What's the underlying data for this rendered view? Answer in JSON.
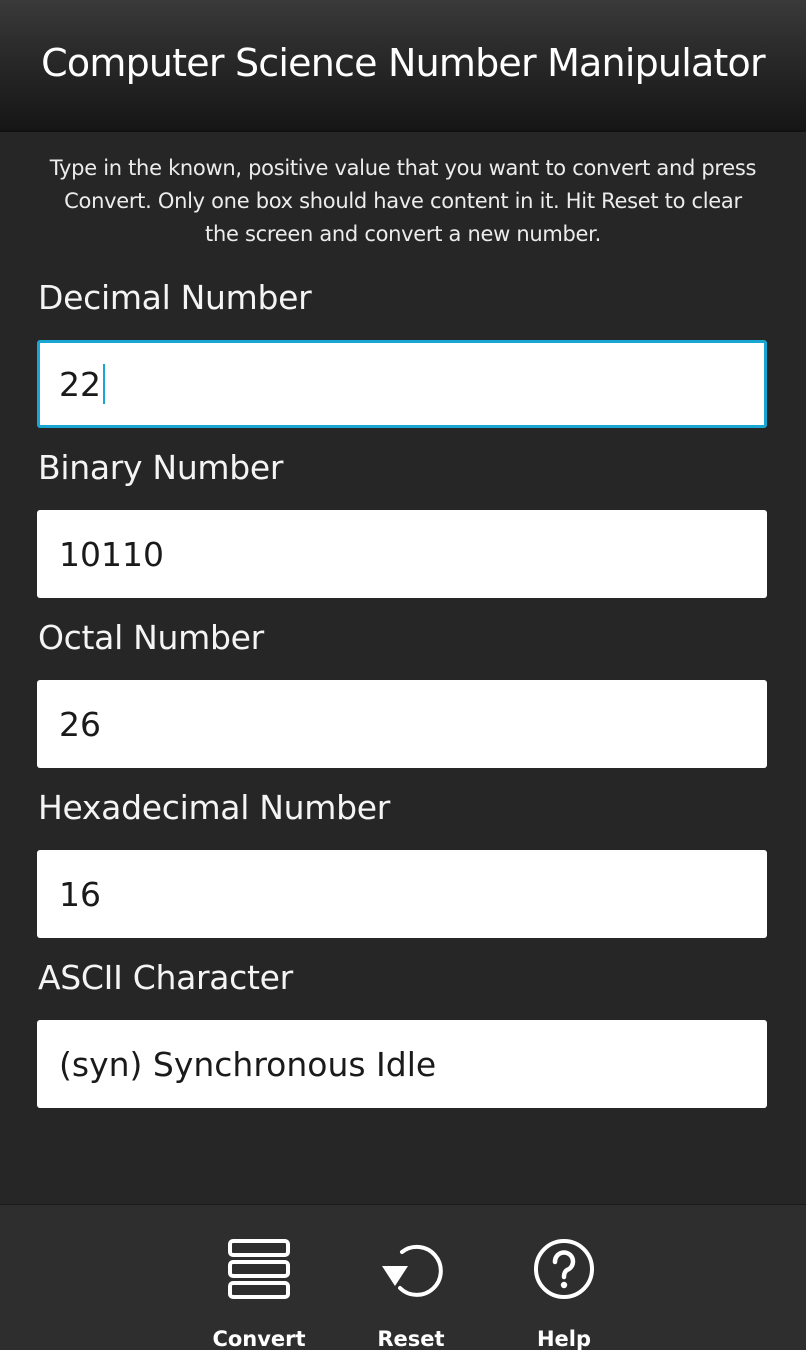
{
  "header": {
    "title": "Computer Science Number Manipulator"
  },
  "instructions": {
    "line1": "Type in the known, positive value that you want to convert and press",
    "line2": "Convert.  Only one box should have content in it.  Hit Reset to clear",
    "line3": "the screen and convert a new number."
  },
  "fields": {
    "decimal": {
      "label": "Decimal Number",
      "value": "22"
    },
    "binary": {
      "label": "Binary Number",
      "value": "10110"
    },
    "octal": {
      "label": "Octal Number",
      "value": "26"
    },
    "hexadecimal": {
      "label": "Hexadecimal Number",
      "value": "16"
    },
    "ascii": {
      "label": "ASCII Character",
      "value": "(syn) Synchronous Idle"
    }
  },
  "actions": {
    "convert": {
      "label": "Convert",
      "icon": "stacked-rows-icon"
    },
    "reset": {
      "label": "Reset",
      "icon": "undo-arrow-icon"
    },
    "help": {
      "label": "Help",
      "icon": "question-circle-icon"
    }
  },
  "colors": {
    "background": "#262626",
    "focus_accent": "#1aa6d2",
    "input_background": "#ffffff"
  }
}
